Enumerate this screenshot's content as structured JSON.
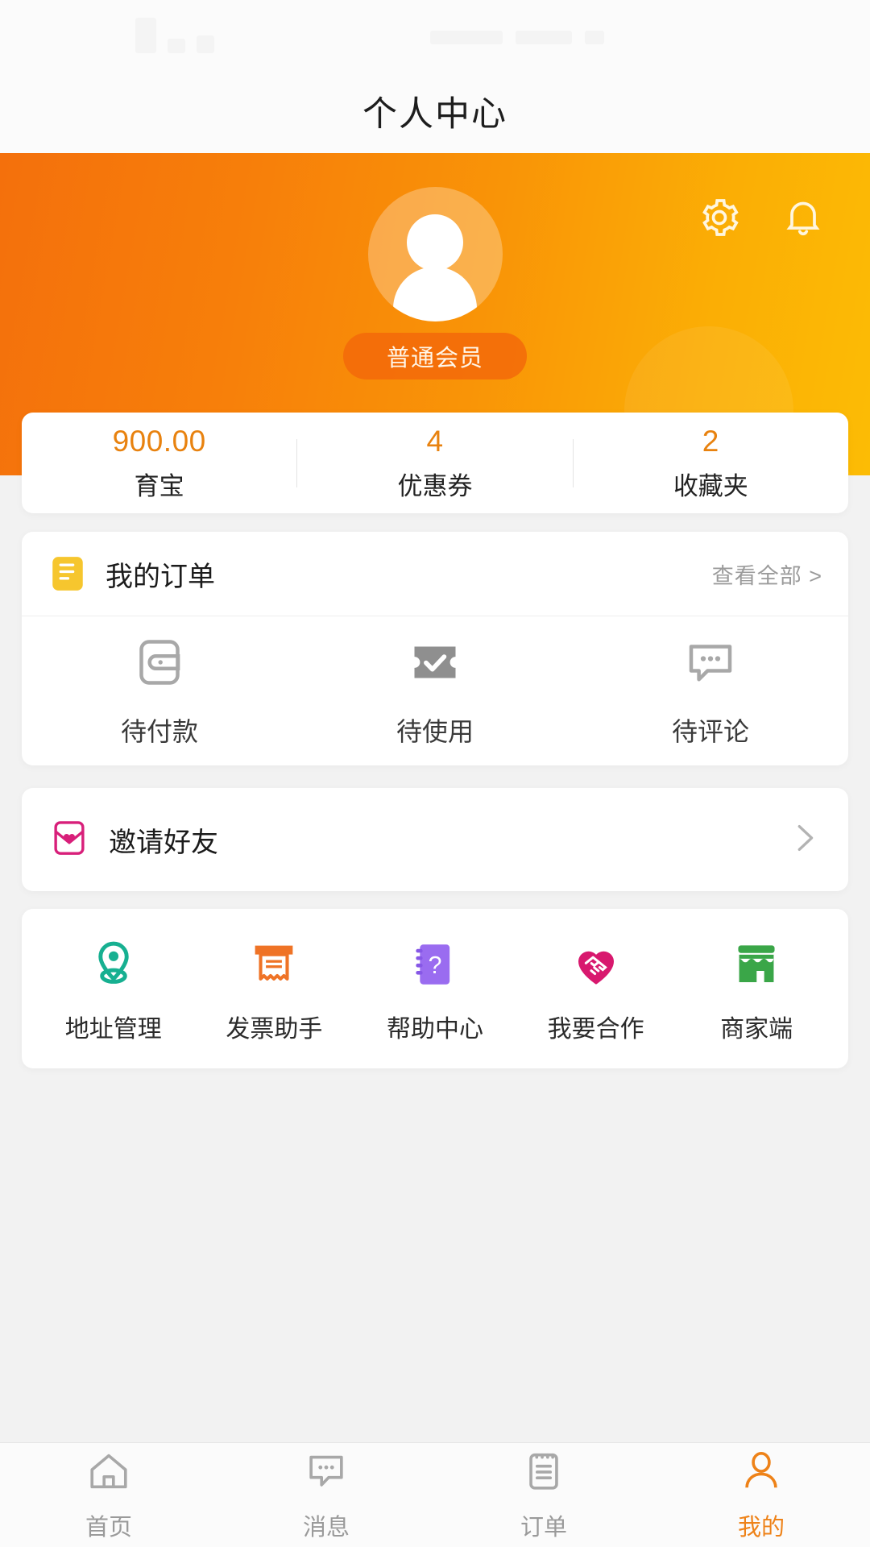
{
  "statusbar": {
    "present": true
  },
  "header": {
    "title": "个人中心"
  },
  "hero": {
    "member_badge": "普通会员",
    "gear_icon": "gear-icon",
    "bell_icon": "bell-icon",
    "avatar_icon": "avatar-person-icon",
    "gradient_from": "#f4700c",
    "gradient_to": "#fcbc05"
  },
  "stats": {
    "accent_color": "#e8820f",
    "items": [
      {
        "value": "900.00",
        "label": "育宝"
      },
      {
        "value": "4",
        "label": "优惠券"
      },
      {
        "value": "2",
        "label": "收藏夹"
      }
    ]
  },
  "orders": {
    "icon": "order-document-icon",
    "icon_color": "#f5c230",
    "title": "我的订单",
    "view_all": "查看全部 >",
    "items": [
      {
        "label": "待付款",
        "icon": "wallet-icon"
      },
      {
        "label": "待使用",
        "icon": "ticket-check-icon"
      },
      {
        "label": "待评论",
        "icon": "comment-dots-icon"
      }
    ]
  },
  "invite": {
    "icon": "envelope-heart-icon",
    "icon_color": "#d81f7a",
    "label": "邀请好友",
    "chevron": "chevron-right-icon"
  },
  "grid": {
    "items": [
      {
        "label": "地址管理",
        "icon": "location-pin-icon",
        "color": "#17b091"
      },
      {
        "label": "发票助手",
        "icon": "receipt-icon",
        "color": "#ef7326"
      },
      {
        "label": "帮助中心",
        "icon": "notebook-question-icon",
        "color": "#9a6cf0"
      },
      {
        "label": "我要合作",
        "icon": "handshake-heart-icon",
        "color": "#d8186e"
      },
      {
        "label": "商家端",
        "icon": "storefront-icon",
        "color": "#3aa648"
      }
    ]
  },
  "tabbar": {
    "active_color": "#ee8218",
    "inactive_color": "#9a9a9a",
    "items": [
      {
        "label": "首页",
        "icon": "home-icon",
        "active": false
      },
      {
        "label": "消息",
        "icon": "message-icon",
        "active": false
      },
      {
        "label": "订单",
        "icon": "clipboard-icon",
        "active": false
      },
      {
        "label": "我的",
        "icon": "person-icon",
        "active": true
      }
    ]
  }
}
